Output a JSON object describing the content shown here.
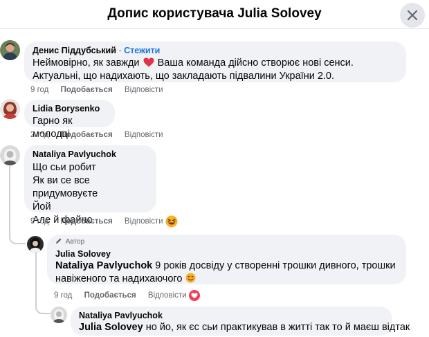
{
  "header": {
    "title": "Допис користувача Julia Solovey"
  },
  "comments": [
    {
      "name": "Денис Піддубський",
      "separator": "·",
      "follow": "Стежити",
      "text_before_emoji": "Неймовірно, як завжди",
      "text_after_emoji": "Ваша команда дійсно створює нові сенси. Актуальні, що надихають, що закладають підвалини України 2.0.",
      "time": "9 год",
      "like": "Подобається",
      "reply": "Відповісти"
    },
    {
      "name": "Lidia Borysenko",
      "text": "Гарно як молодці",
      "time": "2 год",
      "like": "Подобається",
      "reply": "Відповісти"
    },
    {
      "name": "Nataliya Pavlyuchok",
      "lines": [
        "Що сьи робит",
        "Як ви се все придумовуєте",
        "Йой",
        "Але й файно"
      ],
      "time": "9 год",
      "like": "Подобається",
      "reply": "Відповісти"
    }
  ],
  "replies": [
    {
      "badge": "Автор",
      "name": "Julia Solovey",
      "mention": "Nataliya Pavlyuchok",
      "text": "9 років досвіду у створенні трошки дивного, трошки навіженого та надихаючого",
      "time": "9 год",
      "like": "Подобається",
      "reply": "Відповісти"
    },
    {
      "name": "Nataliya Pavlyuchok",
      "mention": "Julia Solovey",
      "text": "но йо, як єс сьи практикував в житті так то й маєш відтак"
    }
  ],
  "colors": {
    "accent": "#1b74e4",
    "bubble": "#f0f2f5",
    "muted": "#65676b",
    "heart": "#f33e58",
    "emoji": "#f7b125"
  },
  "icons": [
    "close-icon",
    "red-heart-emoji",
    "grinning-squint-emoji",
    "smiling-emoji",
    "pencil-icon",
    "love-reaction-icon"
  ]
}
